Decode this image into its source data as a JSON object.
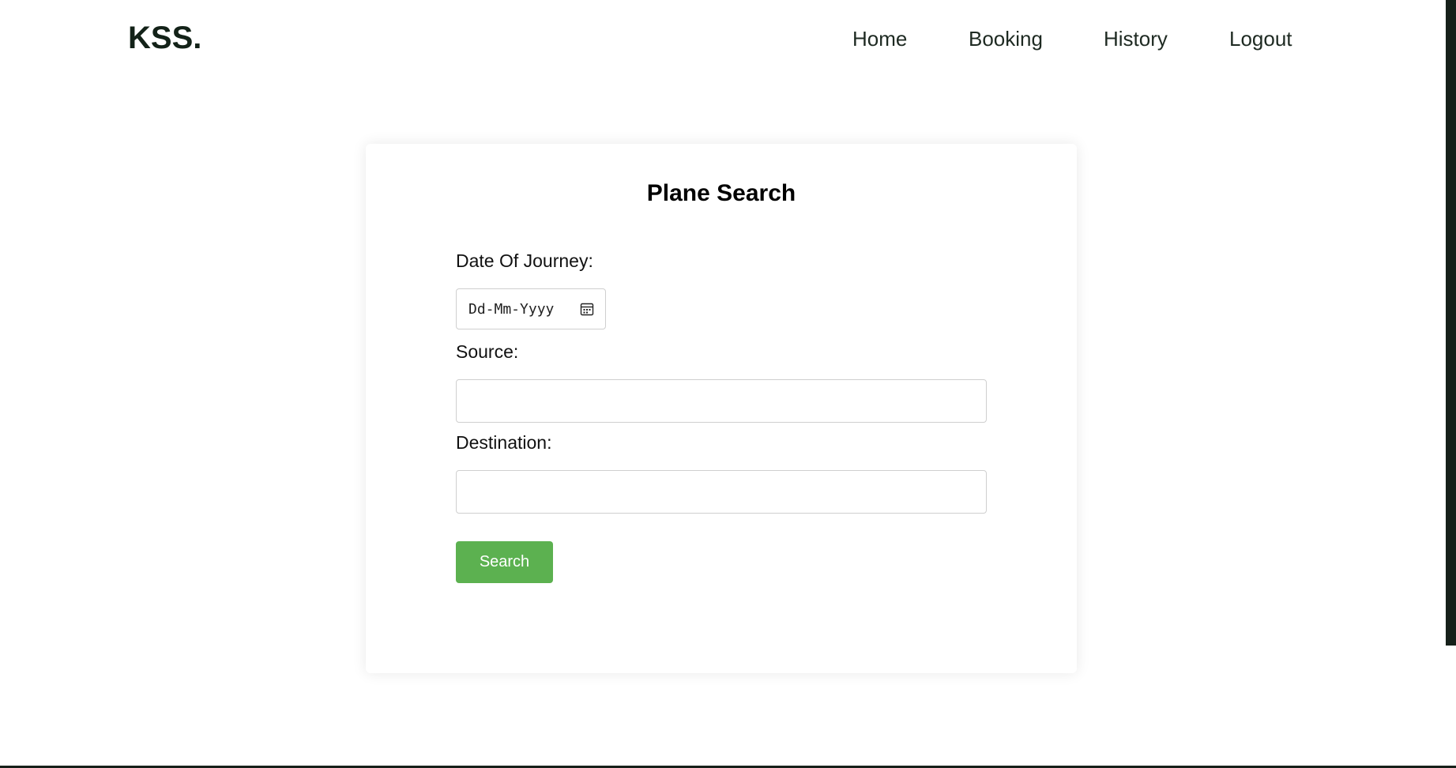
{
  "header": {
    "logo": "KSS.",
    "nav": [
      {
        "label": "Home"
      },
      {
        "label": "Booking"
      },
      {
        "label": "History"
      },
      {
        "label": "Logout"
      }
    ]
  },
  "search_form": {
    "title": "Plane Search",
    "date_label": "Date Of Journey:",
    "date_placeholder": "Dd-Mm-Yyyy",
    "source_label": "Source:",
    "source_value": "",
    "destination_label": "Destination:",
    "destination_value": "",
    "search_button": "Search"
  },
  "colors": {
    "button": "#5cb150",
    "text_dark": "#132218"
  },
  "icons": {
    "date_picker": "calendar-icon"
  }
}
